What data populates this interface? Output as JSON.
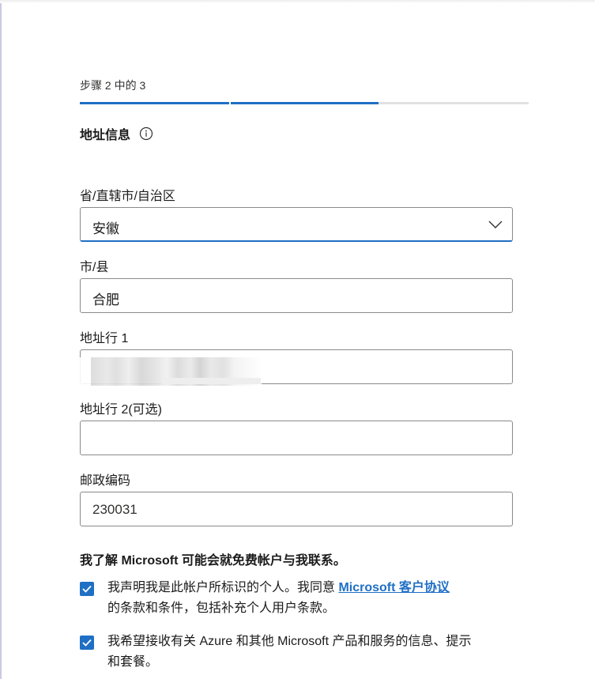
{
  "step": {
    "text": "步骤 2 中的 3",
    "current": 2,
    "total": 3
  },
  "section": {
    "title": "地址信息",
    "info_icon": "info-circle-icon"
  },
  "fields": {
    "province": {
      "label": "省/直辖市/自治区",
      "value": "安徽",
      "icon": "chevron-down-icon"
    },
    "city": {
      "label": "市/县",
      "value": "合肥"
    },
    "address1": {
      "label": "地址行 1",
      "value": ""
    },
    "address2": {
      "label": "地址行 2(可选)",
      "value": ""
    },
    "postal": {
      "label": "邮政编码",
      "value": "230031"
    }
  },
  "notice": "我了解 Microsoft 可能会就免费帐户与我联系。",
  "checks": {
    "agreement": {
      "checked": true,
      "before": "我声明我是此帐户所标识的个人。我同意 ",
      "link": "Microsoft 客户协议",
      "after": "的条款和条件，包括补充个人用户条款。"
    },
    "marketing": {
      "checked": true,
      "text": "我希望接收有关 Azure 和其他 Microsoft 产品和服务的信息、提示和套餐。"
    }
  },
  "colors": {
    "accent": "#1f6fc5",
    "border": "#8a8a8a",
    "track": "#e1e1e1"
  }
}
